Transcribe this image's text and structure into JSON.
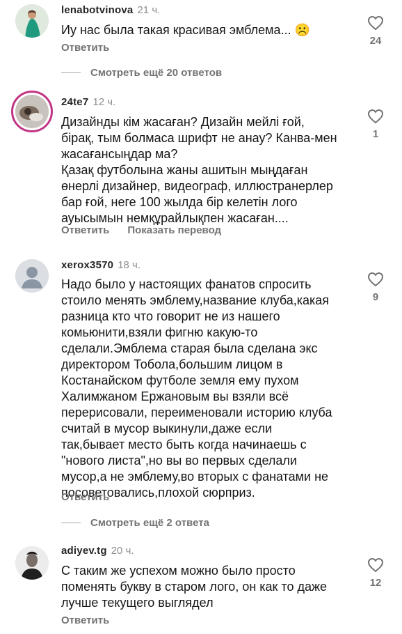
{
  "comments": [
    {
      "username": "lenabotvinova",
      "time": "21 ч.",
      "text": "Иу нас была такая красивая эмблема... ☹️",
      "reply": "Ответить",
      "likes": "24"
    },
    {
      "username": "24te7",
      "time": "12 ч.",
      "text": "Дизайнды кім жасаған? Дизайн мейлі ғой,\nбірақ, тым болмаса шрифт не анау? Канва-мен\nжасағансыңдар ма?\nҚазақ футболына жаны ашитын мыңдаған\nөнерлі дизайнер, видеограф, иллюстранерлер\nбар ғой, неге 100 жылда бір келетін лого\nауысымын немқұрайлықпен жасаған....",
      "reply": "Ответить",
      "translate": "Показать перевод",
      "likes": "1"
    },
    {
      "username": "xerox3570",
      "time": "18 ч.",
      "text": "Надо было у настоящих фанатов спросить\nстоило менять эмблему,название клуба,какая\nразница кто что говорит не из нашего\nкомьюнити,взяли фигню какую-то\nсделали.Эмблема старая была сделана экс\nдиректором Тобола,большим лицом в\nКостанайском футболе земля ему пухом\nХалимжаном Ержановым вы взяли всё\nперерисовали, переименовали историю клуба\nсчитай в мусор выкинули,даже если\nтак,бывает место быть когда начинаешь с\n\"нового листа\",но вы во первых сделали\nмусор,а не эмблему,во вторых с фанатами не\nпосоветовались,плохой сюрприз.",
      "reply": "Ответить",
      "likes": "9"
    },
    {
      "username": "adiyev.tg",
      "time": "20 ч.",
      "text": "С таким же успехом можно было просто\nпоменять букву в старом лого, он как то даже\nлучше текущего выглядел",
      "reply": "Ответить",
      "likes": "12"
    }
  ],
  "more_replies": [
    "Смотреть ещё 20 ответов",
    "Смотреть ещё 2 ответа"
  ]
}
